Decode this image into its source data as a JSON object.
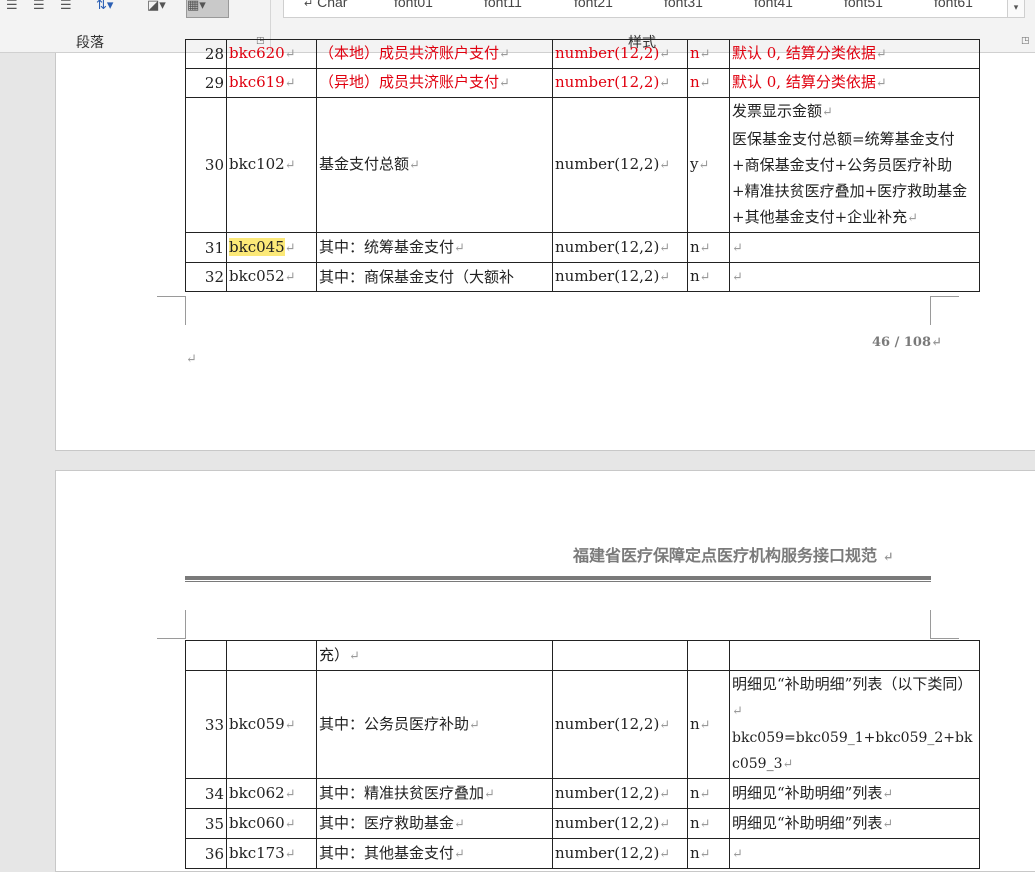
{
  "ribbon": {
    "paragraph_group": "段落",
    "styles_group": "样式",
    "styles": [
      "Char",
      "font01",
      "font11",
      "font21",
      "font31",
      "font41",
      "font51",
      "font61"
    ],
    "icons": [
      "align-center-icon",
      "align-right-icon",
      "justify-icon",
      "line-spacing-icon",
      "shading-icon",
      "borders-icon"
    ]
  },
  "para_mark": "↵",
  "page1": {
    "rows": [
      {
        "no": "28",
        "code": "bkc620",
        "name": "（本地）成员共济账户支付",
        "type": "number(12,2)",
        "flag": "n",
        "remark": "默认 0, 结算分类依据",
        "red": true
      },
      {
        "no": "29",
        "code": "bkc619",
        "name": "（异地）成员共济账户支付",
        "type": "number(12,2)",
        "flag": "n",
        "remark": "默认 0, 结算分类依据",
        "red": true
      },
      {
        "no": "30",
        "code": "bkc102",
        "name": "基金支付总额",
        "type": "number(12,2)",
        "flag": "y",
        "remark": "发票显示金额",
        "remark2": "医保基金支付总额=统筹基金支付+商保基金支付+公务员医疗补助+精准扶贫医疗叠加+医疗救助基金+其他基金支付+企业补充"
      },
      {
        "no": "31",
        "code": "bkc045",
        "name": "其中：统筹基金支付",
        "type": "number(12,2)",
        "flag": "n",
        "remark": ""
      },
      {
        "no": "32",
        "code": "bkc052",
        "name": "其中：商保基金支付（大额补",
        "type": "number(12,2)",
        "flag": "n",
        "remark": ""
      }
    ],
    "page_number": "46 / 108"
  },
  "page2": {
    "header_title": "福建省医疗保障定点医疗机构服务接口规范",
    "rows": [
      {
        "no": "",
        "code": "",
        "name": "充）",
        "type": "",
        "flag": "",
        "remark": ""
      },
      {
        "no": "33",
        "code": "bkc059",
        "name": "其中：公务员医疗补助",
        "type": "number(12,2)",
        "flag": "n",
        "remark": "明细见“补助明细”列表（以下类同）",
        "remark2": "bkc059=bkc059_1+bkc059_2+bkc059_3"
      },
      {
        "no": "34",
        "code": "bkc062",
        "name": "其中：精准扶贫医疗叠加",
        "type": "number(12,2)",
        "flag": "n",
        "remark": "明细见“补助明细”列表"
      },
      {
        "no": "35",
        "code": "bkc060",
        "name": "其中：医疗救助基金",
        "type": "number(12,2)",
        "flag": "n",
        "remark": "明细见“补助明细”列表"
      },
      {
        "no": "36",
        "code": "bkc173",
        "name": "其中：其他基金支付",
        "type": "number(12,2)",
        "flag": "n",
        "remark": ""
      }
    ]
  }
}
